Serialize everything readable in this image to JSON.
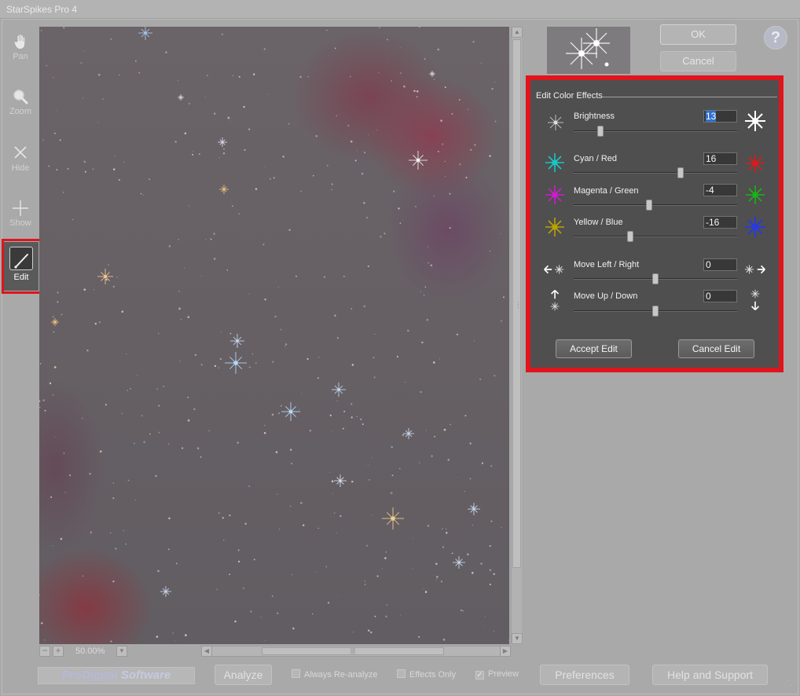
{
  "window": {
    "title": "StarSpikes Pro 4"
  },
  "tools": [
    {
      "label": "Pan",
      "icon": "hand-icon"
    },
    {
      "label": "Zoom",
      "icon": "magnifier-icon"
    },
    {
      "label": "Hide",
      "icon": "x-icon"
    },
    {
      "label": "Show",
      "icon": "plus-icon"
    },
    {
      "label": "Edit",
      "icon": "brush-icon",
      "active": true
    }
  ],
  "preview": {
    "zoom": "50.00%"
  },
  "buttons": {
    "ok": "OK",
    "cancel": "Cancel",
    "help": "?"
  },
  "edit_panel": {
    "title": "Edit Color Effects",
    "controls": [
      {
        "label": "Brightness",
        "value": "13",
        "slider_fraction": 0.15
      },
      {
        "label": "Cyan / Red",
        "value": "16",
        "slider_fraction": 0.66
      },
      {
        "label": "Magenta / Green",
        "value": "-4",
        "slider_fraction": 0.46
      },
      {
        "label": "Yellow / Blue",
        "value": "-16",
        "slider_fraction": 0.34
      },
      {
        "label": "Move Left / Right",
        "value": "0",
        "slider_fraction": 0.5
      },
      {
        "label": "Move Up / Down",
        "value": "0",
        "slider_fraction": 0.5
      }
    ],
    "accept_label": "Accept Edit",
    "cancel_label": "Cancel Edit",
    "colors": {
      "cyan": "#19c6c6",
      "red": "#e01818",
      "magenta": "#d01ad0",
      "green": "#18b418",
      "yellow": "#b8a400",
      "blue": "#2a3ae0",
      "highlight": "#e0141c"
    }
  },
  "bottom": {
    "brand_part1": "ProDigital",
    "brand_part2": "Software",
    "analyze": "Analyze",
    "always_reanalyze": "Always Re-analyze",
    "effects_only": "Effects Only",
    "preview": "Preview",
    "preview_checked": true,
    "preferences": "Preferences",
    "help_support": "Help and Support"
  }
}
